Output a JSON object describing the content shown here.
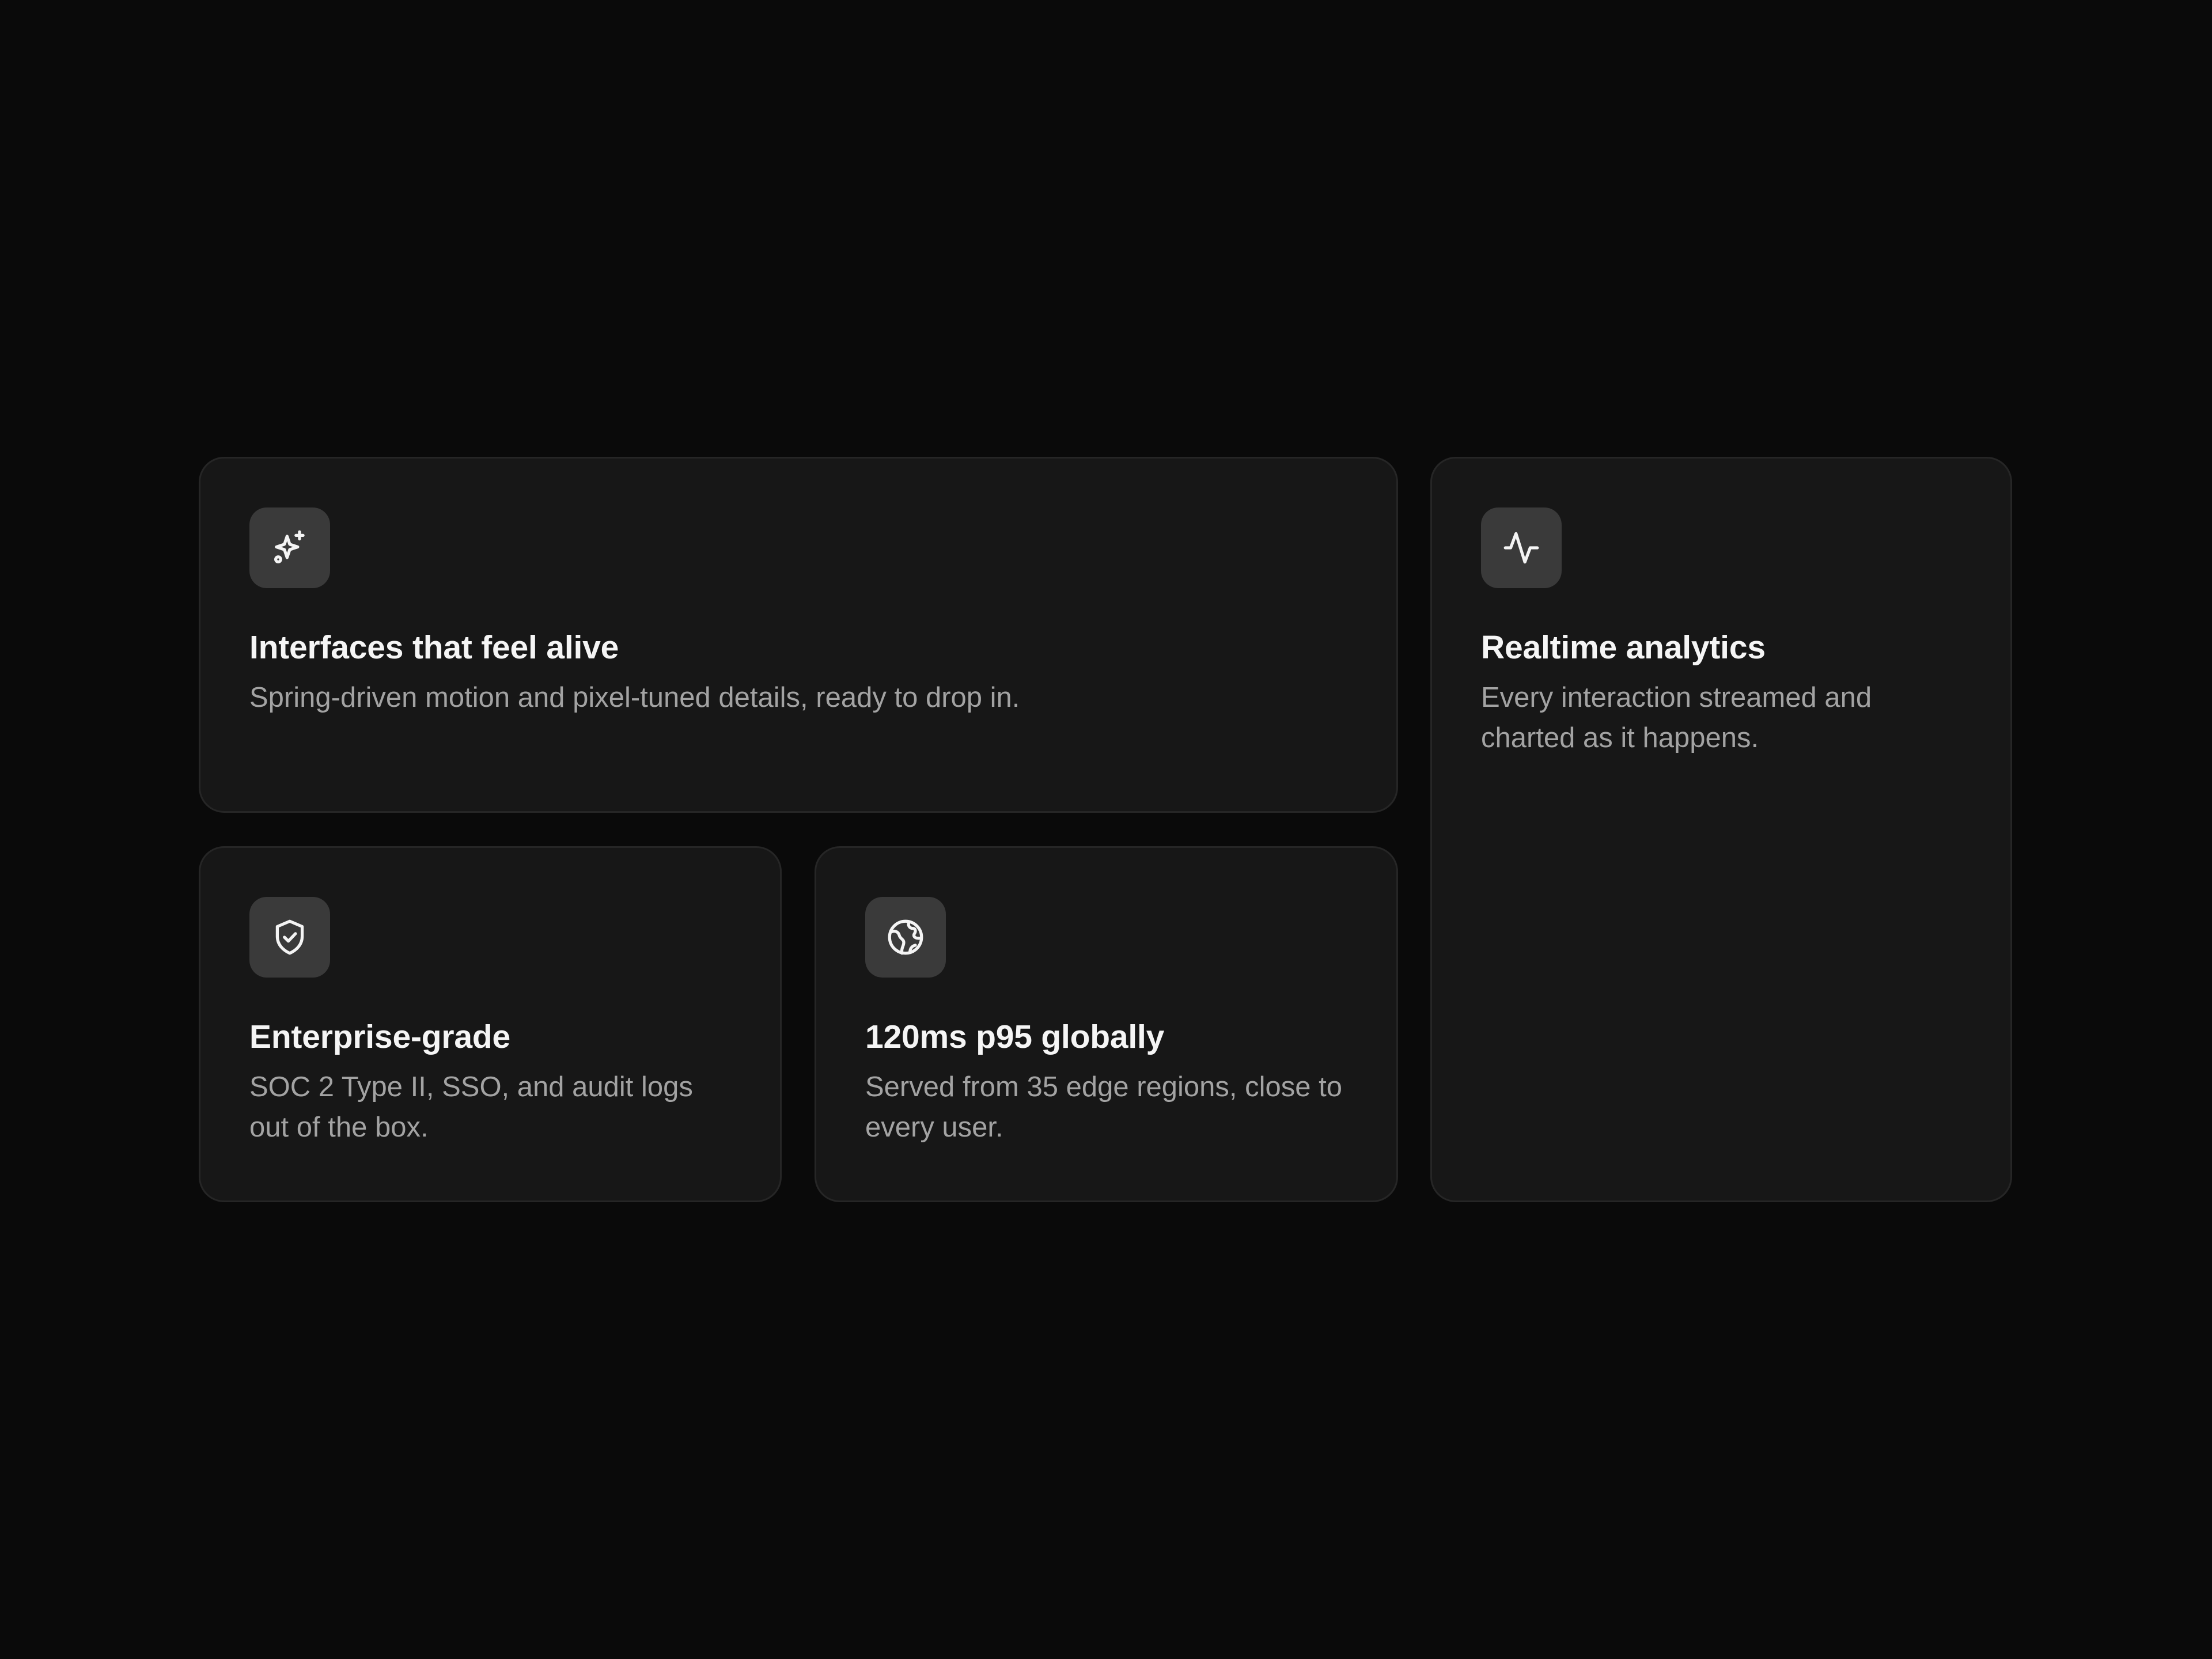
{
  "theme": {
    "background": "#0a0a0a",
    "card_background": "#171717",
    "card_border": "#262626",
    "icon_tile": "#3a3a3a",
    "title_color": "#f5f5f5",
    "description_color": "#a3a3a3"
  },
  "cards": [
    {
      "icon": "sparkles-icon",
      "title": "Interfaces that feel alive",
      "description": "Spring-driven motion and pixel-tuned details, ready to drop in."
    },
    {
      "icon": "activity-pulse-icon",
      "title": "Realtime analytics",
      "description": "Every interaction streamed and charted as it happens."
    },
    {
      "icon": "shield-check-icon",
      "title": "Enterprise-grade",
      "description": "SOC 2 Type II, SSO, and audit logs out of the box."
    },
    {
      "icon": "globe-icon",
      "title": "120ms p95 globally",
      "description": "Served from 35 edge regions, close to every user."
    }
  ]
}
